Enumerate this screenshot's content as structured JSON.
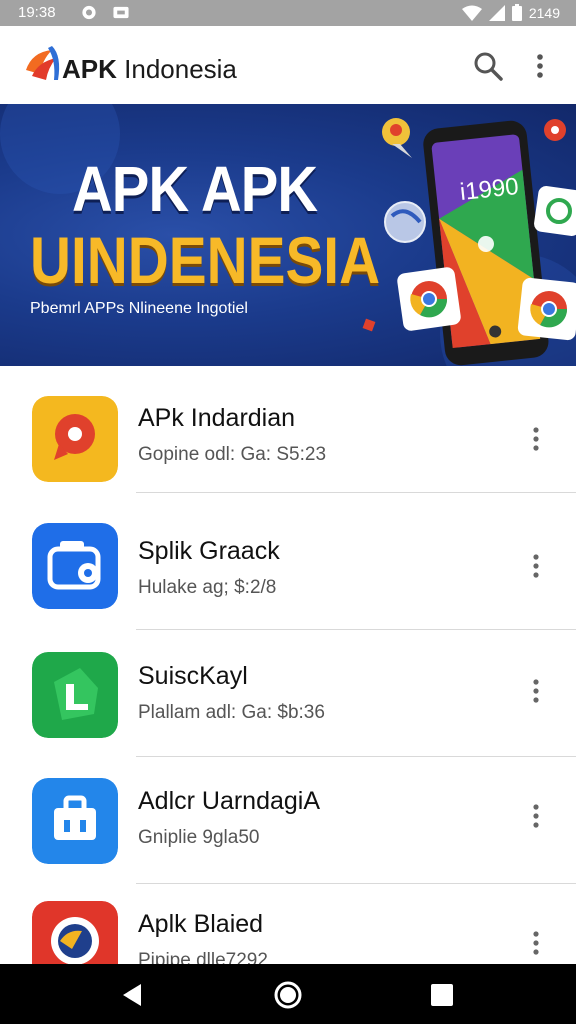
{
  "status_bar": {
    "time": "19:38",
    "battery_text": "2149",
    "icons": [
      "alarm-icon",
      "notification-icon",
      "wifi-icon",
      "signal-icon",
      "battery-icon"
    ]
  },
  "app_bar": {
    "brand_bold": "APK",
    "brand_rest": " Indonesia",
    "icons": [
      "search-icon",
      "more-vert-icon"
    ]
  },
  "banner": {
    "title_line1": "APK APK",
    "title_line2": "UINDENESIA",
    "subtitle": "Pbemrl APPs Nlineene Ingotiel",
    "phone_screen_text": "i1990",
    "colors": {
      "background": "#1b3b8c",
      "title2": "#f7b928"
    }
  },
  "apps": [
    {
      "name": "APk Indardian",
      "subtitle": "Gopine odl: Ga: S5:23",
      "icon": "map-pin-icon"
    },
    {
      "name": "Splik Graack",
      "subtitle": "Hulake ag; $:2/8",
      "icon": "camera-app-icon"
    },
    {
      "name": "SuiscKayl",
      "subtitle": "Plallam adl: Ga: $b:36",
      "icon": "green-l-app-icon"
    },
    {
      "name": "Adlcr UarndagiA",
      "subtitle": "Gniplie 9gla50",
      "icon": "briefcase-app-icon"
    },
    {
      "name": "Aplk Blaied",
      "subtitle": "Pipipe dlle7292",
      "icon": "red-round-app-icon"
    }
  ],
  "nav_bar": {
    "icons": [
      "back-icon",
      "home-icon",
      "recents-icon"
    ]
  }
}
